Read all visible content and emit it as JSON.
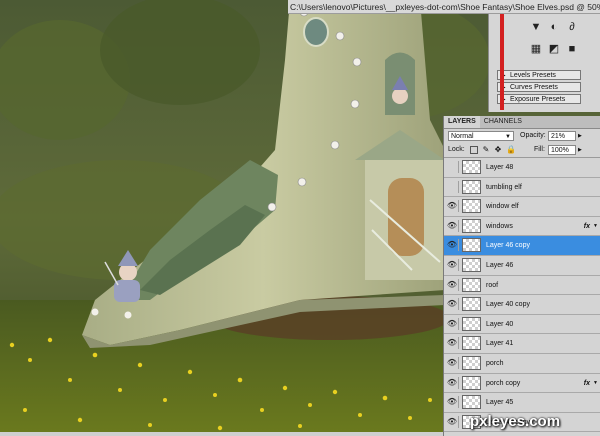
{
  "window": {
    "title": "C:\\Users\\lenovo\\Pictures\\__pxleyes-dot-com\\Shoe Fantasy\\Shoe Elves.psd @ 50% (Layer 46 cop"
  },
  "presets": {
    "items": [
      "Levels Presets",
      "Curves Presets",
      "Exposure Presets"
    ]
  },
  "layers_panel": {
    "tabs": [
      "LAYERS",
      "CHANNELS"
    ],
    "blend_mode": "Normal",
    "opacity_label": "Opacity:",
    "opacity_value": "21%",
    "lock_label": "Lock:",
    "fill_label": "Fill:",
    "fill_value": "100%",
    "selected_layer": "Layer 46 copy",
    "layers": [
      {
        "name": "Layer 48",
        "visible": false,
        "fx": false
      },
      {
        "name": "tumbling elf",
        "visible": false,
        "fx": false
      },
      {
        "name": "window elf",
        "visible": true,
        "fx": false
      },
      {
        "name": "windows",
        "visible": true,
        "fx": true
      },
      {
        "name": "Layer 46 copy",
        "visible": true,
        "fx": false
      },
      {
        "name": "Layer 46",
        "visible": true,
        "fx": false
      },
      {
        "name": "roof",
        "visible": true,
        "fx": false
      },
      {
        "name": "Layer 40 copy",
        "visible": true,
        "fx": false
      },
      {
        "name": "Layer 40",
        "visible": true,
        "fx": false
      },
      {
        "name": "Layer 41",
        "visible": true,
        "fx": false
      },
      {
        "name": "porch",
        "visible": true,
        "fx": false
      },
      {
        "name": "porch copy",
        "visible": true,
        "fx": true
      },
      {
        "name": "Layer 45",
        "visible": true,
        "fx": false
      },
      {
        "name": "Layer 44 copy",
        "visible": true,
        "fx": false
      }
    ],
    "fx_label": "fx"
  },
  "watermark": "pxleyes.com",
  "icons": {
    "visibility": "eye-icon",
    "lock": "lock-icon",
    "fx": "fx-icon"
  },
  "colors": {
    "selection": "#3a8de0",
    "panel": "#d4d4d4"
  }
}
